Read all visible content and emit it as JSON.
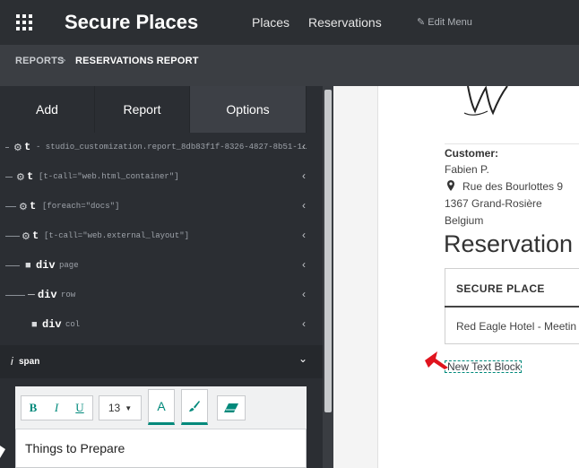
{
  "header": {
    "app_title": "Secure Places",
    "nav": [
      "Places",
      "Reservations"
    ],
    "edit_menu": "Edit Menu"
  },
  "breadcrumb": {
    "parent": "REPORTS",
    "separator": ">",
    "current": "RESERVATIONS REPORT"
  },
  "sidebar": {
    "tabs": [
      {
        "label": "Add",
        "active": false
      },
      {
        "label": "Report",
        "active": false
      },
      {
        "label": "Options",
        "active": true
      }
    ],
    "tree": [
      {
        "tag": "t",
        "attr": "- studio_customization.report_8db83f1f-8326-4827-8b51-1…",
        "icon": "gear-icon"
      },
      {
        "tag": "t",
        "attr": "[t-call=\"web.html_container\"]",
        "icon": "gear-icon"
      },
      {
        "tag": "t",
        "attr": "[foreach=\"docs\"]",
        "icon": "gear-icon"
      },
      {
        "tag": "t",
        "attr": "[t-call=\"web.external_layout\"]",
        "icon": "gear-icon"
      },
      {
        "tag": "div",
        "attr": "page",
        "icon": "folder-icon"
      },
      {
        "tag": "div",
        "attr": "row",
        "icon": "folder-icon"
      },
      {
        "tag": "div",
        "attr": "col",
        "icon": "folder-icon"
      }
    ],
    "span_panel": {
      "icon": "i",
      "label": "span"
    }
  },
  "editor": {
    "bold": "B",
    "italic": "I",
    "underline": "U",
    "font_size": "13",
    "font_color_icon": "A",
    "text": "Things to Prepare"
  },
  "document": {
    "customer_label": "Customer:",
    "customer_name": "Fabien P.",
    "street": "Rue des Bourlottes 9",
    "city": "1367 Grand-Rosière",
    "country": "Belgium",
    "heading": "Reservation",
    "table_header": "SECURE PLACE",
    "table_cell": "Red Eagle Hotel - Meetin",
    "new_block": "New Text Block"
  },
  "colors": {
    "accent": "#00897b",
    "topbar": "#2c2f33",
    "arrow": "#e0141e"
  }
}
